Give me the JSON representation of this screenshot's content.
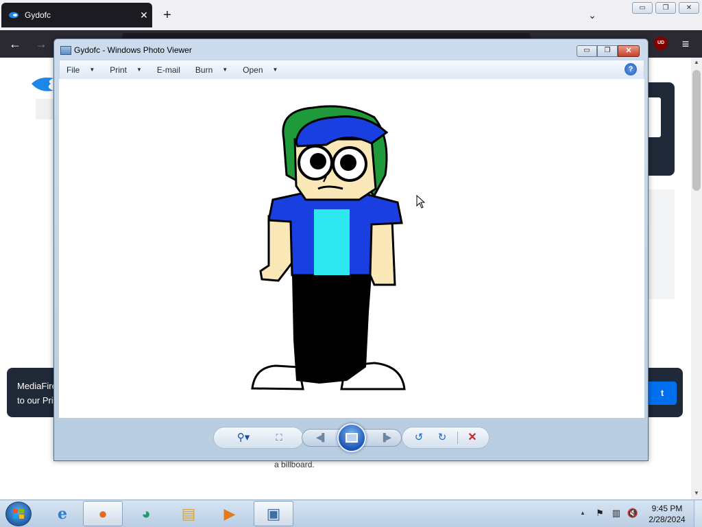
{
  "browser": {
    "tab_title": "Gydofc",
    "tab_close": "✕",
    "new_tab": "+",
    "tab_list": "⌄",
    "back": "←",
    "forward": "→",
    "menu": "≡",
    "ublock_label": "UD"
  },
  "window_buttons": {
    "minimize": "▭",
    "restore": "❐",
    "close": "✕"
  },
  "page": {
    "cookie_text": "MediaFire\nto our Pri",
    "cookie_button": "t",
    "billboard_text": "a billboard.",
    "scroll_up": "▲",
    "scroll_down": "▼"
  },
  "photo_viewer": {
    "title": "Gydofc - Windows Photo Viewer",
    "controls": {
      "minimize": "▭",
      "maximize": "❐",
      "close": "✕"
    },
    "menu": [
      {
        "label": "File",
        "has_dropdown": true
      },
      {
        "label": "Print",
        "has_dropdown": true
      },
      {
        "label": "E-mail",
        "has_dropdown": false
      },
      {
        "label": "Burn",
        "has_dropdown": true
      },
      {
        "label": "Open",
        "has_dropdown": true
      }
    ],
    "help": "?",
    "toolbar": {
      "zoom": "⚲▾",
      "actual_size": "⛶",
      "previous": "◀▌",
      "next": "▐▶",
      "rotate_left": "↺",
      "rotate_right": "↻",
      "delete": "✕"
    }
  },
  "taskbar": {
    "apps": [
      {
        "name": "internet-explorer",
        "glyph": "e",
        "color": "#2b7fd8"
      },
      {
        "name": "firefox",
        "glyph": "●",
        "color": "#e56a1c"
      },
      {
        "name": "edge-green",
        "glyph": "◕",
        "color": "#1e9a6a"
      },
      {
        "name": "file-explorer",
        "glyph": "▤",
        "color": "#d9a53a"
      },
      {
        "name": "media-player",
        "glyph": "▶",
        "color": "#e27a1c"
      },
      {
        "name": "photo-viewer",
        "glyph": "▣",
        "color": "#3f6ea5"
      }
    ],
    "tray": {
      "show_hidden": "▲",
      "flag": "⚑",
      "network": "▥",
      "volume": "🔇"
    },
    "time": "9:45 PM",
    "date": "2/28/2024"
  },
  "colors": {
    "browser_dark": "#2b2a33",
    "tab_dark": "#1c1b22",
    "cookie_bg": "#1f2937",
    "cookie_button": "#0070f0",
    "hair_green": "#1e9a3a",
    "hair_blue": "#1a3fe0",
    "shirt_cyan": "#2ee8f0",
    "skin": "#fbe8b8"
  }
}
